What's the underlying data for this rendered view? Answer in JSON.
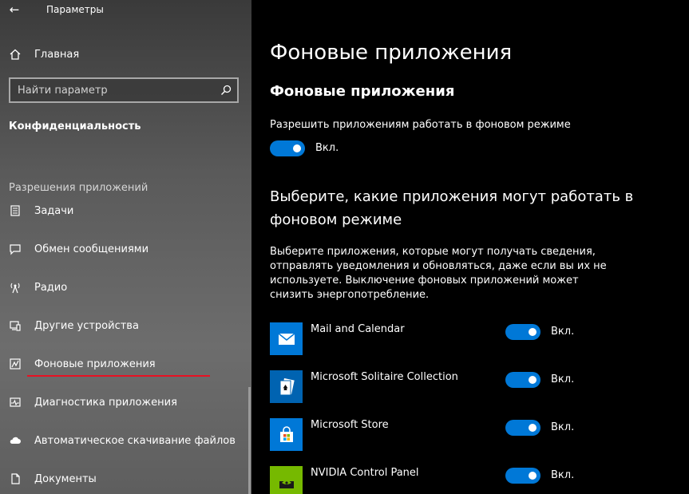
{
  "window": {
    "title": "Параметры",
    "back_glyph": "←"
  },
  "sidebar": {
    "home": {
      "label": "Главная",
      "icon": "home-icon"
    },
    "search": {
      "placeholder": "Найти параметр",
      "value": ""
    },
    "section_title": "Конфиденциальность",
    "group_label": "Разрешения приложений",
    "items": [
      {
        "label": "Задачи",
        "icon": "tasks-icon"
      },
      {
        "label": "Обмен сообщениями",
        "icon": "message-icon"
      },
      {
        "label": "Радио",
        "icon": "radio-icon"
      },
      {
        "label": "Другие устройства",
        "icon": "devices-icon"
      },
      {
        "label": "Фоновые приложения",
        "icon": "background-apps-icon",
        "active": true
      },
      {
        "label": "Диагностика приложения",
        "icon": "diagnostics-icon"
      },
      {
        "label": "Автоматическое скачивание файлов",
        "icon": "cloud-icon"
      },
      {
        "label": "Документы",
        "icon": "document-icon"
      }
    ]
  },
  "main": {
    "title": "Фоновые приложения",
    "subtitle": "Фоновые приложения",
    "master_setting": {
      "label": "Разрешить приложениям работать в фоновом режиме",
      "state_text": "Вкл.",
      "on": true
    },
    "choose_heading": "Выберите, какие приложения могут работать в фоновом режиме",
    "description": "Выберите приложения, которые могут получать сведения, отправлять уведомления и обновляться, даже если вы их не используете. Выключение фоновых приложений может снизить энергопотребление.",
    "apps": [
      {
        "name": "Mail and Calendar",
        "state_text": "Вкл.",
        "on": true,
        "icon": "mail-icon",
        "tile_color": "#0078d7"
      },
      {
        "name": "Microsoft Solitaire Collection",
        "state_text": "Вкл.",
        "on": true,
        "icon": "solitaire-icon",
        "tile_color": "#0063b1"
      },
      {
        "name": "Microsoft Store",
        "state_text": "Вкл.",
        "on": true,
        "icon": "store-icon",
        "tile_color": "#0078d7"
      },
      {
        "name": "NVIDIA Control Panel",
        "state_text": "Вкл.",
        "on": true,
        "icon": "nvidia-icon",
        "tile_color": "#76b900"
      }
    ]
  },
  "colors": {
    "accent": "#0078d7",
    "underline": "#e81123"
  }
}
